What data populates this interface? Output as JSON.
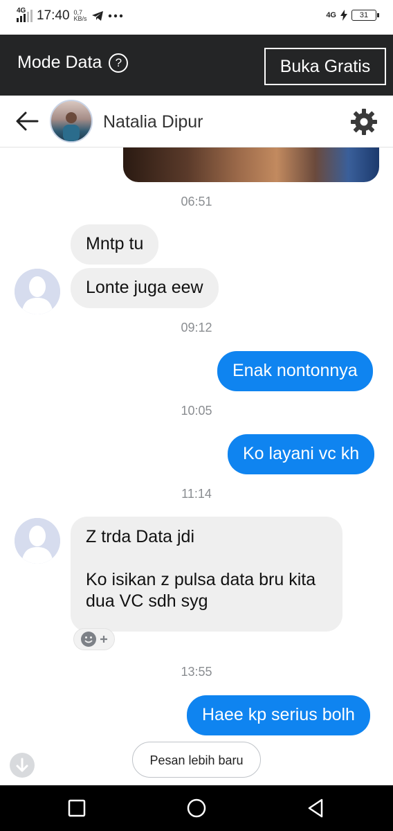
{
  "status_bar": {
    "network": "4G",
    "time": "17:40",
    "speed_value": "0,7",
    "speed_unit": "KB/s",
    "icons": [
      "telegram-icon",
      "more-dots-icon"
    ],
    "right_network": "4G",
    "battery": "31"
  },
  "mode_bar": {
    "label": "Mode Data",
    "help": "?",
    "button": "Buka Gratis",
    "bg_color": "#242526"
  },
  "chat_header": {
    "contact_name": "Natalia Dipur",
    "icons": [
      "back-arrow-icon",
      "gear-icon"
    ]
  },
  "messages": {
    "timestamps": [
      "06:51",
      "09:12",
      "10:05",
      "11:14",
      "13:55"
    ],
    "incoming_1": "Mntp tu",
    "incoming_2": "Lonte juga eew",
    "outgoing_1": "Enak nontonnya",
    "outgoing_2": "Ko layani vc kh",
    "incoming_3_line1": "Z trda Data jdi",
    "incoming_3_line2": "Ko isikan z pulsa data bru kita",
    "incoming_3_line3": "dua VC sdh syg",
    "outgoing_3": "Haee kp serius bolh",
    "outgoing_color": "#0f84f0",
    "incoming_color": "#efefef"
  },
  "newer_button": "Pesan lebih baru",
  "nav_icons": [
    "recent-apps-icon",
    "home-icon",
    "back-icon"
  ]
}
